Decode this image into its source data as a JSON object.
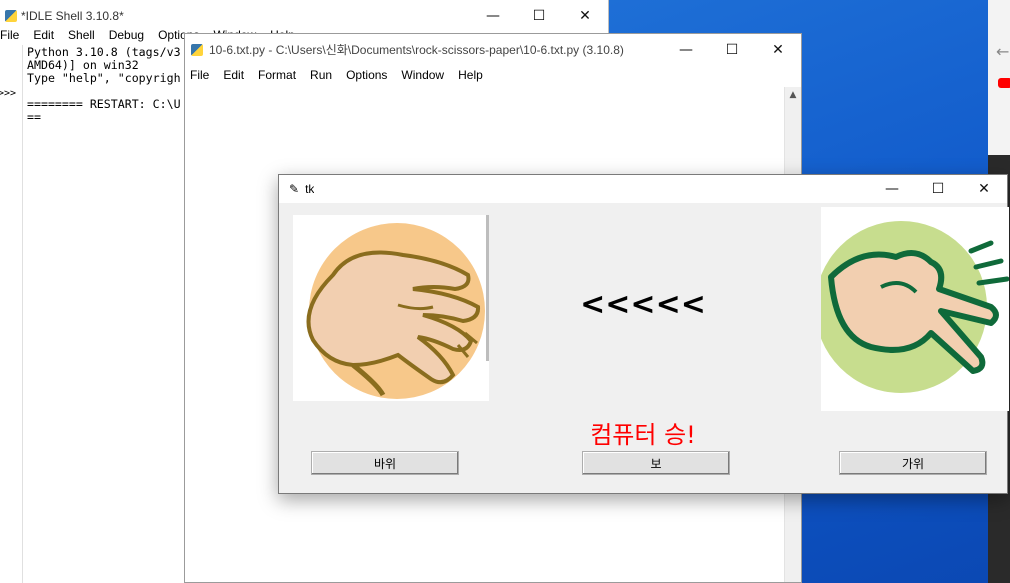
{
  "shell": {
    "title": "*IDLE Shell 3.10.8*",
    "menu": [
      "File",
      "Edit",
      "Shell",
      "Debug",
      "Options",
      "Window",
      "Help"
    ],
    "prompt": ">>>",
    "lines": [
      "Python 3.10.8 (tags/v3",
      "AMD64)] on win32",
      "Type \"help\", \"copyrigh",
      "",
      "======== RESTART: C:\\U",
      "=="
    ]
  },
  "editor": {
    "title": "10-6.txt.py - C:\\Users\\신화\\Documents\\rock-scissors-paper\\10-6.txt.py (3.10.8)",
    "menu": [
      "File",
      "Edit",
      "Format",
      "Run",
      "Options",
      "Window",
      "Help"
    ]
  },
  "tk": {
    "title": "tk",
    "compare": "<<<<<",
    "result": "컴퓨터 승!",
    "buttons": [
      "바위",
      "보",
      "가위"
    ],
    "result_color": "#ff0000"
  },
  "colors": {
    "keyword": "#ff7700",
    "string": "#00aa00",
    "comment": "#dd0000",
    "builtin": "#900090",
    "desktop": "#0f57c9"
  },
  "icons": [
    "minimize-icon",
    "maximize-icon",
    "close-icon",
    "python-feather-icon",
    "scroll-up-icon",
    "back-arrow-icon"
  ]
}
